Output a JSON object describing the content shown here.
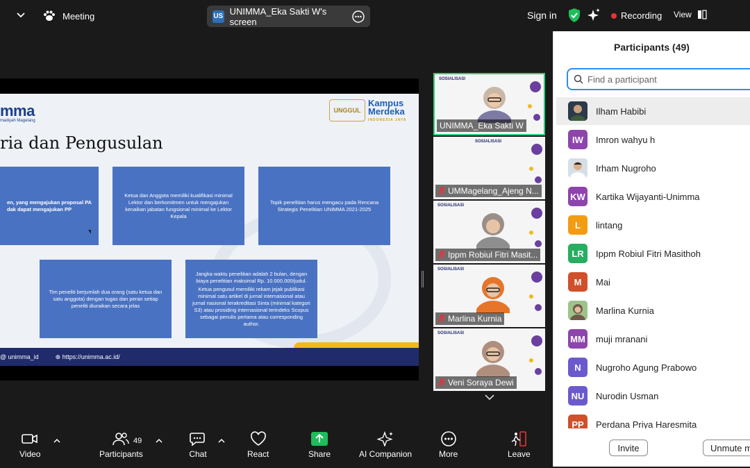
{
  "topbar": {
    "meeting_label": "Meeting",
    "share_badge": "US",
    "share_label": "UNIMMA_Eka Sakti W's screen",
    "sign_in": "Sign in",
    "recording": "Recording",
    "view": "View"
  },
  "slide": {
    "logo": "mma",
    "logo_sub": "madiyah Magelang",
    "unggul": "UNGGUL",
    "kampus": "Kampus Merdeka",
    "kampus_sub": "INDONESIA JAYA",
    "title": "ria dan Pengusulan",
    "box1": "en, yang mengajukan proposal PA dak dapat mengajukan PP",
    "box2": "Ketua dan Anggota memiliki kualifikasi minimal Lektor dan berkomitmen untuk mengajukan kenaikan jabatan fungsional minimal ke Lektor Kepala",
    "box3": "Topik penelitian harus mengacu pada Rencana Strategis Penelitian UNIMMA 2021-2025",
    "box4": "Tim peneliti berjumlah dua orang (satu ketua dan satu anggota) dengan tugas dan peran setiap peneliti diuraikan secara jelas",
    "box5a": "Jangka waktu penelitian adalah 2 bulan, dengan biaya penelitian maksimal Rp. 10.000.000/judul.",
    "box5b": "Ketua pengusul memiliki rekam jejak publikasi minimal satu artikel di jurnal internasional atau jurnal nasional terakreditasi Sinta (minimal kategori S3) atau prosiding internasional terindeks Scopus sebagai penulis pertama atau corresponding author.",
    "footer_ig": "unimma_id",
    "footer_web": "https://unimma.ac.id/"
  },
  "videos": [
    {
      "name": "UNIMMA_Eka Sakti W",
      "muted": false,
      "poster": "SOSIALISASI"
    },
    {
      "name": "UMMagelang_Ajeng N...",
      "muted": true,
      "poster": "SOSIALISASI"
    },
    {
      "name": "Ippm Robiul Fitri Masit...",
      "muted": true,
      "poster": "SOSIALISASI"
    },
    {
      "name": "Marlina Kurnia",
      "muted": true,
      "poster": "SOSIALISASI"
    },
    {
      "name": "Veni Soraya Dewi",
      "muted": true,
      "poster": "SOSIALISASI"
    }
  ],
  "panel": {
    "title": "Participants (49)",
    "search_placeholder": "Find a participant",
    "invite": "Invite",
    "unmute": "Unmute me",
    "participants": [
      {
        "initials": "",
        "name": "Ilham Habibi",
        "color": "#2b3a4a",
        "photo": true
      },
      {
        "initials": "IW",
        "name": "Imron wahyu h",
        "color": "#8e44ad",
        "photo": false
      },
      {
        "initials": "",
        "name": "Irham Nugroho",
        "color": "#b8c4d0",
        "photo": true
      },
      {
        "initials": "KW",
        "name": "Kartika Wijayanti-Unimma",
        "color": "#8e44ad",
        "photo": false
      },
      {
        "initials": "L",
        "name": "lintang",
        "color": "#f39c12",
        "photo": false
      },
      {
        "initials": "LR",
        "name": "Ippm Robiul Fitri Masithoh",
        "color": "#27ae60",
        "photo": false
      },
      {
        "initials": "M",
        "name": "Mai",
        "color": "#d0502a",
        "photo": false
      },
      {
        "initials": "",
        "name": "Marlina Kurnia",
        "color": "#7aa27a",
        "photo": true
      },
      {
        "initials": "MM",
        "name": "muji mranani",
        "color": "#8e44ad",
        "photo": false
      },
      {
        "initials": "N",
        "name": "Nugroho Agung Prabowo",
        "color": "#6a5acd",
        "photo": false
      },
      {
        "initials": "NU",
        "name": "Nurodin Usman",
        "color": "#6a5acd",
        "photo": false
      },
      {
        "initials": "PP",
        "name": "Perdana Priya Haresmita",
        "color": "#d0502a",
        "photo": false
      }
    ]
  },
  "toolbar": {
    "video": "Video",
    "participants": "Participants",
    "participants_count": "49",
    "chat": "Chat",
    "react": "React",
    "share": "Share",
    "ai": "AI Companion",
    "more": "More",
    "leave": "Leave"
  },
  "colors": {
    "accent": "#2d8cff",
    "share_green": "#1dbe5b",
    "recording_red": "#e5343a",
    "active_speaker": "#29d17b",
    "slide_box": "#4a72c2"
  }
}
